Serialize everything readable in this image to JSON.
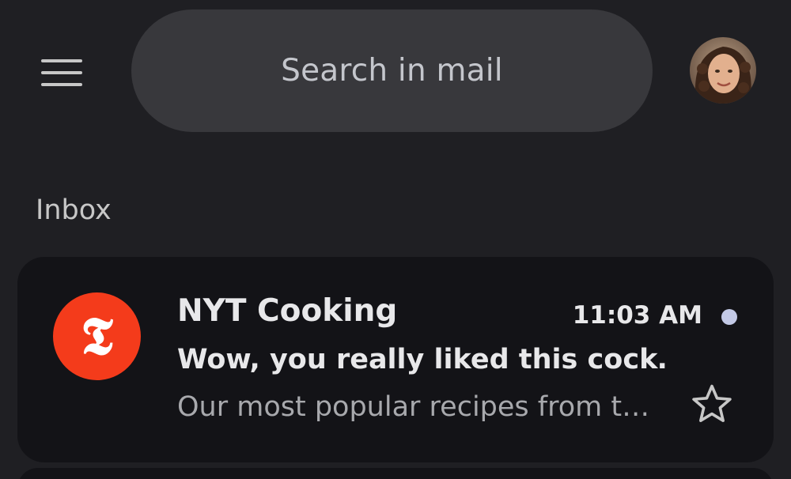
{
  "header": {
    "menu_icon": "hamburger-menu-icon",
    "search_placeholder": "Search in mail",
    "avatar_icon": "account-avatar"
  },
  "inbox": {
    "label": "Inbox",
    "emails": [
      {
        "sender": "NYT Cooking",
        "sender_logo_glyph": "𝕿",
        "time": "11:03 AM",
        "subject": "Wow, you really liked this cock…",
        "snippet": "Our most popular recipes from t…",
        "unread": true,
        "starred": false
      }
    ]
  },
  "colors": {
    "background": "#1f1f23",
    "search_bg": "#38383c",
    "card_bg": "#131317",
    "nyt_red": "#f43b1b",
    "unread_dot": "#c3c9e6"
  }
}
